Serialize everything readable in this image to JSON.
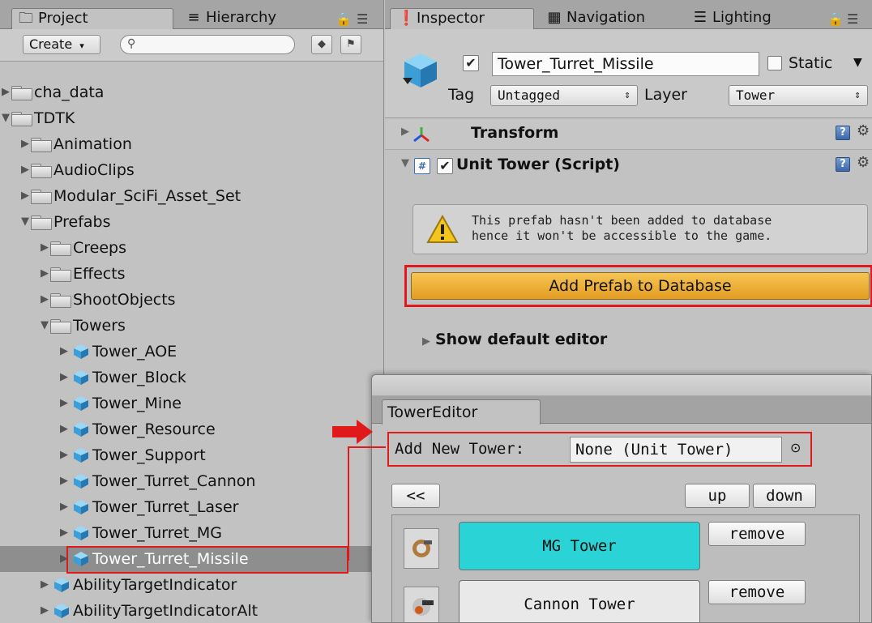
{
  "project_panel": {
    "tabs": {
      "project": "Project",
      "hierarchy": "Hierarchy"
    },
    "create_label": "Create",
    "tree": [
      {
        "label": "cha_data",
        "indent": 0,
        "kind": "folder",
        "expanded": false
      },
      {
        "label": "TDTK",
        "indent": 0,
        "kind": "folder",
        "expanded": true
      },
      {
        "label": "Animation",
        "indent": 1,
        "kind": "folder",
        "expanded": false
      },
      {
        "label": "AudioClips",
        "indent": 1,
        "kind": "folder",
        "expanded": false
      },
      {
        "label": "Modular_SciFi_Asset_Set",
        "indent": 1,
        "kind": "folder",
        "expanded": false
      },
      {
        "label": "Prefabs",
        "indent": 1,
        "kind": "folder",
        "expanded": true
      },
      {
        "label": "Creeps",
        "indent": 2,
        "kind": "folder",
        "expanded": false
      },
      {
        "label": "Effects",
        "indent": 2,
        "kind": "folder",
        "expanded": false
      },
      {
        "label": "ShootObjects",
        "indent": 2,
        "kind": "folder",
        "expanded": false
      },
      {
        "label": "Towers",
        "indent": 2,
        "kind": "folder",
        "expanded": true
      },
      {
        "label": "Tower_AOE",
        "indent": 3,
        "kind": "prefab",
        "expanded": false
      },
      {
        "label": "Tower_Block",
        "indent": 3,
        "kind": "prefab",
        "expanded": false
      },
      {
        "label": "Tower_Mine",
        "indent": 3,
        "kind": "prefab",
        "expanded": false
      },
      {
        "label": "Tower_Resource",
        "indent": 3,
        "kind": "prefab",
        "expanded": false
      },
      {
        "label": "Tower_Support",
        "indent": 3,
        "kind": "prefab",
        "expanded": false
      },
      {
        "label": "Tower_Turret_Cannon",
        "indent": 3,
        "kind": "prefab",
        "expanded": false
      },
      {
        "label": "Tower_Turret_Laser",
        "indent": 3,
        "kind": "prefab",
        "expanded": false
      },
      {
        "label": "Tower_Turret_MG",
        "indent": 3,
        "kind": "prefab",
        "expanded": false
      },
      {
        "label": "Tower_Turret_Missile",
        "indent": 3,
        "kind": "prefab",
        "expanded": false,
        "selected": true
      },
      {
        "label": "AbilityTargetIndicator",
        "indent": 2,
        "kind": "prefab",
        "expanded": false
      },
      {
        "label": "AbilityTargetIndicatorAlt",
        "indent": 2,
        "kind": "prefab",
        "expanded": false
      }
    ]
  },
  "inspector": {
    "tabs": {
      "inspector": "Inspector",
      "navigation": "Navigation",
      "lighting": "Lighting"
    },
    "object_name": "Tower_Turret_Missile",
    "static_label": "Static",
    "tag_label": "Tag",
    "tag_value": "Untagged",
    "layer_label": "Layer",
    "layer_value": "Tower",
    "transform_label": "Transform",
    "script_label": "Unit Tower (Script)",
    "warning_line1": "This prefab hasn't been added to database",
    "warning_line2": "hence it won't be accessible to the game.",
    "add_prefab_label": "Add Prefab to Database",
    "show_default_label": "Show default editor"
  },
  "tower_editor": {
    "tab_label": "TowerEditor",
    "add_new_label": "Add New Tower:",
    "add_new_value": "None (Unit Tower)",
    "back_label": "<<",
    "up_label": "up",
    "down_label": "down",
    "entries": [
      {
        "name": "MG Tower",
        "remove_label": "remove",
        "color": "#2ad4d6"
      },
      {
        "name": "Cannon Tower",
        "remove_label": "remove",
        "color": "#e9e9e9"
      }
    ]
  },
  "colors": {
    "highlight": "#e01a1a",
    "add_prefab_button": "#eeae35",
    "mg_tower_button": "#2ad4d6",
    "selection": "#8e8e8e"
  }
}
